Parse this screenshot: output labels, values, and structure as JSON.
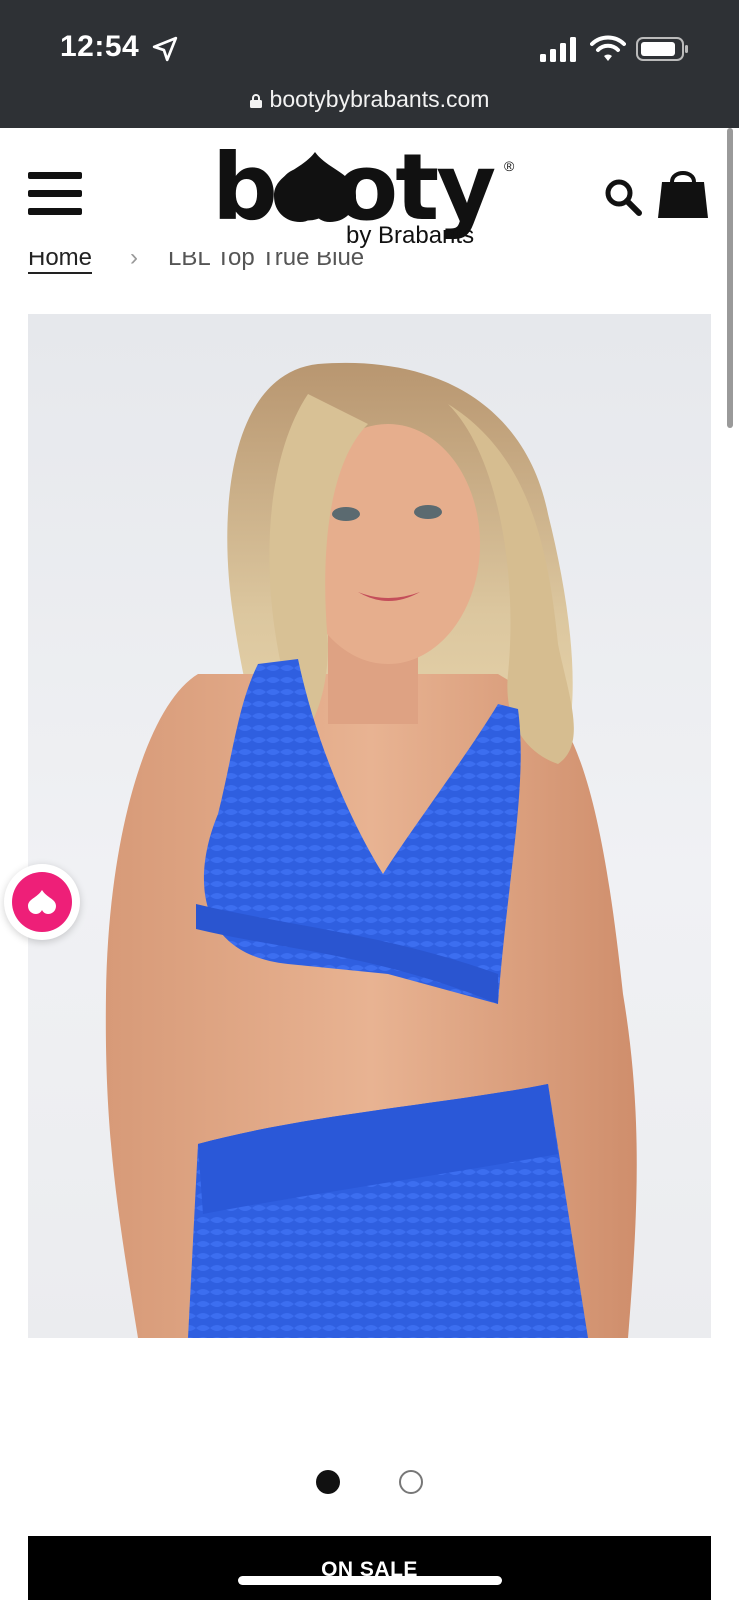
{
  "status_bar": {
    "time": "12:54",
    "url": "bootybybrabants.com"
  },
  "header": {
    "logo_text": "booty",
    "logo_sub": "by Brabants",
    "logo_mark": "®",
    "icons": [
      "menu-icon",
      "search-icon",
      "shopping-bag-icon"
    ]
  },
  "breadcrumb": {
    "home": "Home",
    "separator": "›",
    "current": "LBL Top True Blue"
  },
  "product": {
    "image_alt": "Model wearing blue textured sports bra and leggings",
    "carousel": {
      "current": 1,
      "total": 2
    }
  },
  "wishlist": {
    "icon": "heart-icon",
    "color": "#ee1f78"
  },
  "sale_banner": {
    "label": "ON SALE"
  },
  "colors": {
    "status_bar": "#2e3135",
    "accent_pink": "#ee1f78",
    "product_blue": "#2f5fe0",
    "banner": "#000000"
  }
}
